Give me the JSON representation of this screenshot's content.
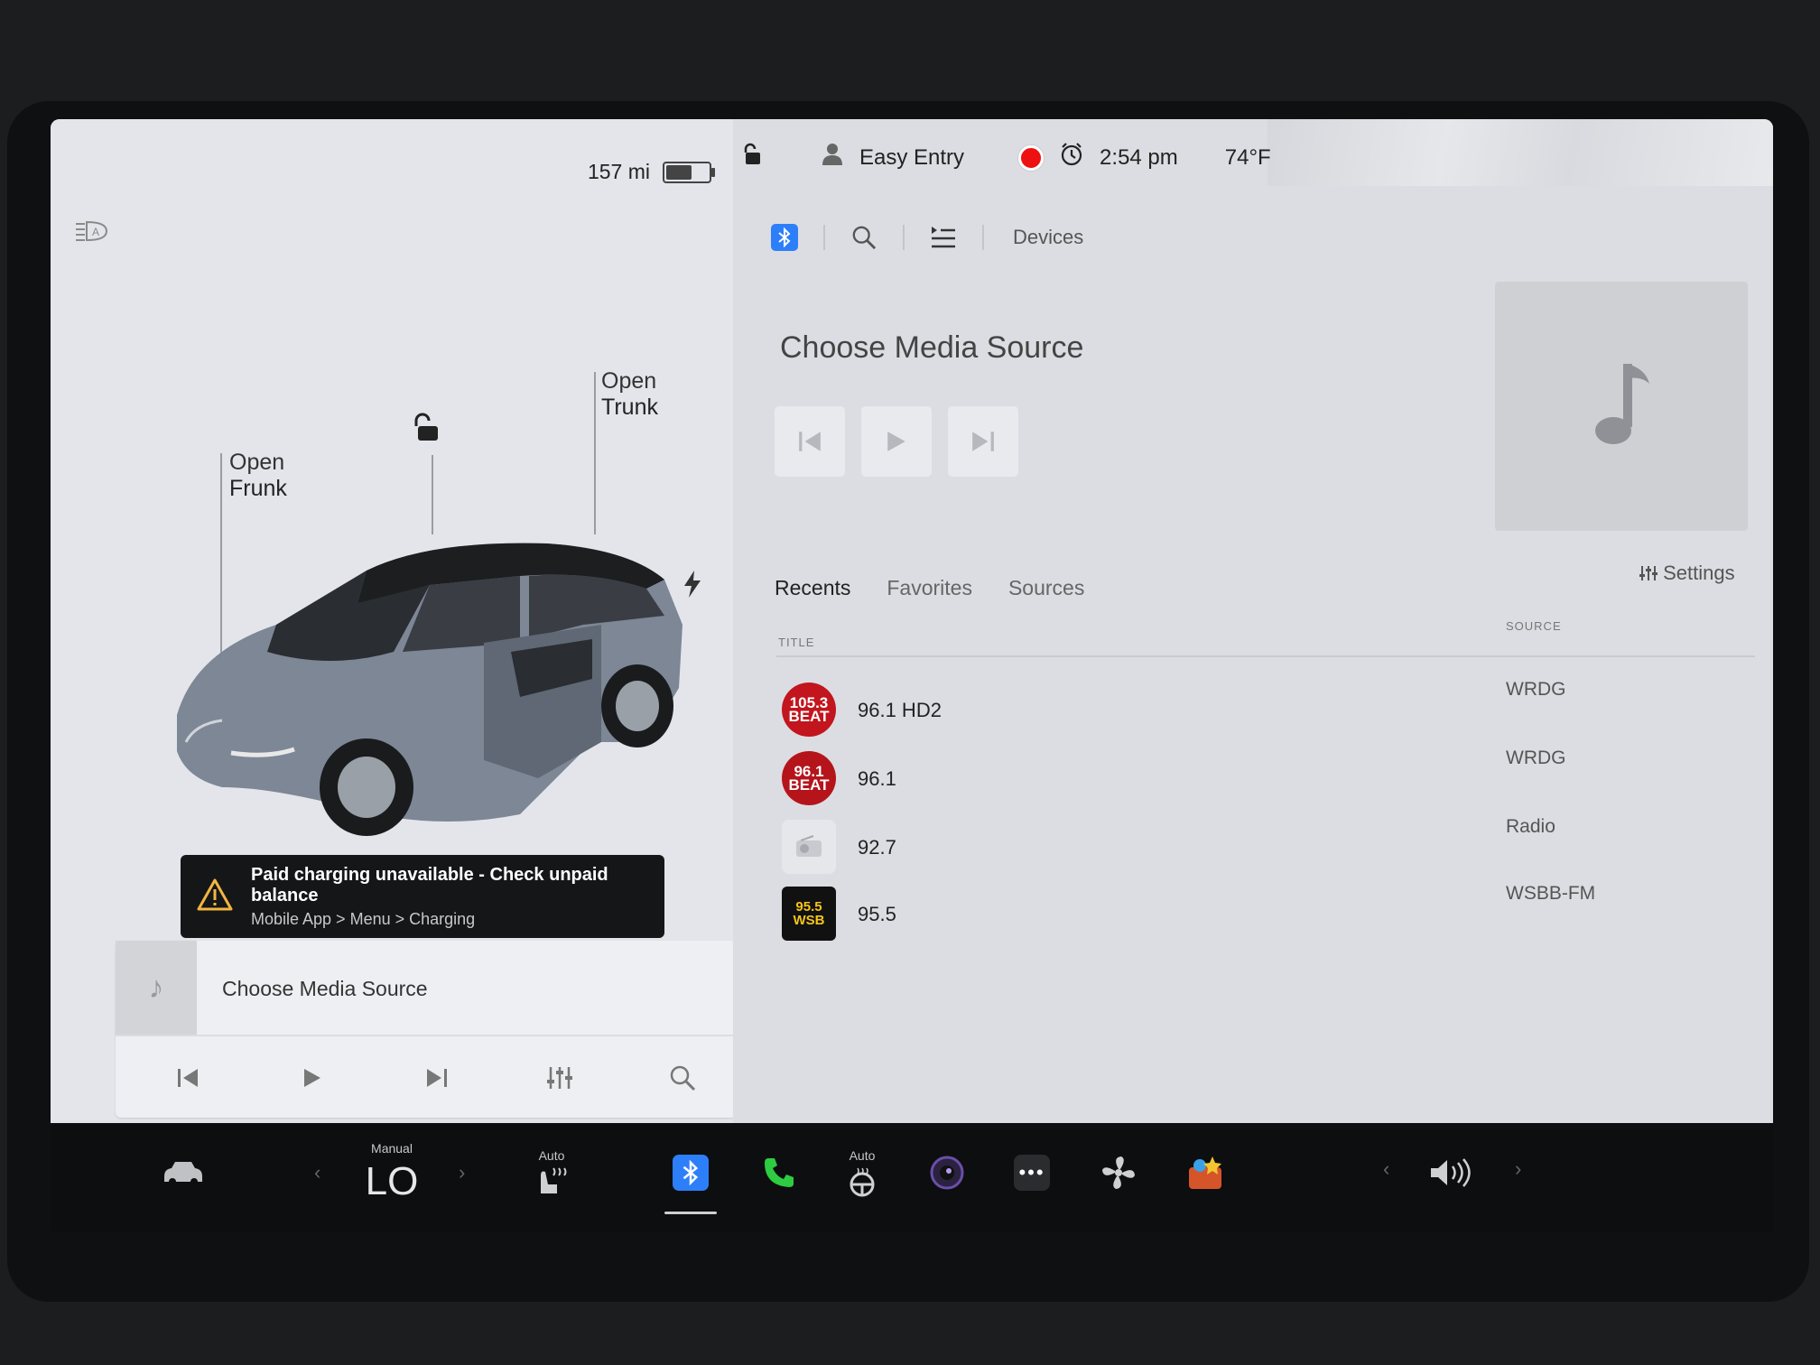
{
  "status": {
    "range": "157 mi",
    "profile": "Easy Entry",
    "time": "2:54 pm",
    "temperature": "74°F"
  },
  "car": {
    "open_frunk": [
      "Open",
      "Frunk"
    ],
    "open_trunk": [
      "Open",
      "Trunk"
    ]
  },
  "alert": {
    "title": "Paid charging unavailable - Check unpaid balance",
    "subtitle": "Mobile App > Menu > Charging"
  },
  "mini_player": {
    "title": "Choose Media Source"
  },
  "media": {
    "devices_tab": "Devices",
    "title": "Choose Media Source",
    "settings_label": "Settings",
    "tabs": [
      "Recents",
      "Favorites",
      "Sources"
    ],
    "col_title": "TITLE",
    "col_source": "SOURCE",
    "rows": [
      {
        "logo_text": "105.3 BEAT",
        "title": "96.1 HD2",
        "source": "WRDG"
      },
      {
        "logo_text": "96.1 BEAT",
        "title": "96.1",
        "source": "WRDG"
      },
      {
        "logo_text": "",
        "title": "92.7",
        "source": "Radio"
      },
      {
        "logo_text": "95.5 WSB",
        "title": "95.5",
        "source": "WSBB-FM"
      }
    ]
  },
  "dock": {
    "climate_mode": "Manual",
    "climate_temp": "LO",
    "seat_heat_mode": "Auto",
    "wheel_heat_mode": "Auto"
  },
  "colors": {
    "bluetooth": "#2d7ff9",
    "record": "#e11111",
    "phone": "#2ecc40",
    "alert_bg": "#151618"
  }
}
